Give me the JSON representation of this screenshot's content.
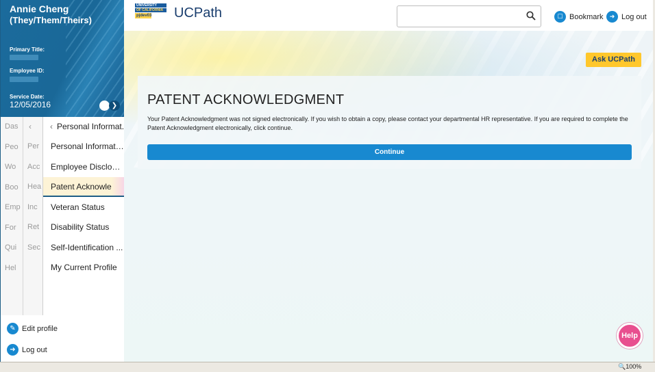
{
  "profile": {
    "name": "Annie Cheng",
    "pronouns": "(They/Them/Theirs)",
    "primary_title_label": "Primary Title:",
    "employee_id_label": "Employee ID:",
    "service_date_label": "Service Date:",
    "service_date": "12/05/2016"
  },
  "nav": {
    "col_a": [
      "Das",
      "Peo",
      "Wo",
      "Boo",
      "Emp",
      "For",
      "Qui",
      "Hel"
    ],
    "col_b": [
      "Per",
      "Acc",
      "Hea",
      "Inc",
      "Ret",
      "Sec"
    ],
    "back_label": "Personal Informat...",
    "items": [
      {
        "label": "Personal Informati..."
      },
      {
        "label": "Employee Disclosu..."
      },
      {
        "label": "Patent Acknowled..."
      },
      {
        "label": "Veteran Status"
      },
      {
        "label": "Disability Status"
      },
      {
        "label": "Self-Identification ..."
      },
      {
        "label": "My Current Profile"
      }
    ]
  },
  "side_links": {
    "edit_profile": "Edit profile",
    "log_out": "Log out"
  },
  "header": {
    "badge_line1": "UNIVERSITY",
    "badge_line2": "OF CALIFORNIA",
    "badge_env": "pjdev03",
    "app_title": "UCPath",
    "search_value": "",
    "bookmark_label": "Bookmark",
    "logout_label": "Log out"
  },
  "ask_label": "Ask UCPath",
  "card": {
    "title": "PATENT ACKNOWLEDGMENT",
    "message": "Your Patent Acknowledgment was not signed electronically. If you wish to obtain a copy, please contact your departmental HR representative. If you are required to complete the Patent Acknowledgment electronically, click continue.",
    "continue_label": "Continue"
  },
  "help_label": "Help",
  "status": {
    "zoom": "🔍100%"
  },
  "colors": {
    "primary": "#1889d0",
    "brand": "#1a6898",
    "accent": "#ffc72c",
    "help": "#e84f8f"
  }
}
